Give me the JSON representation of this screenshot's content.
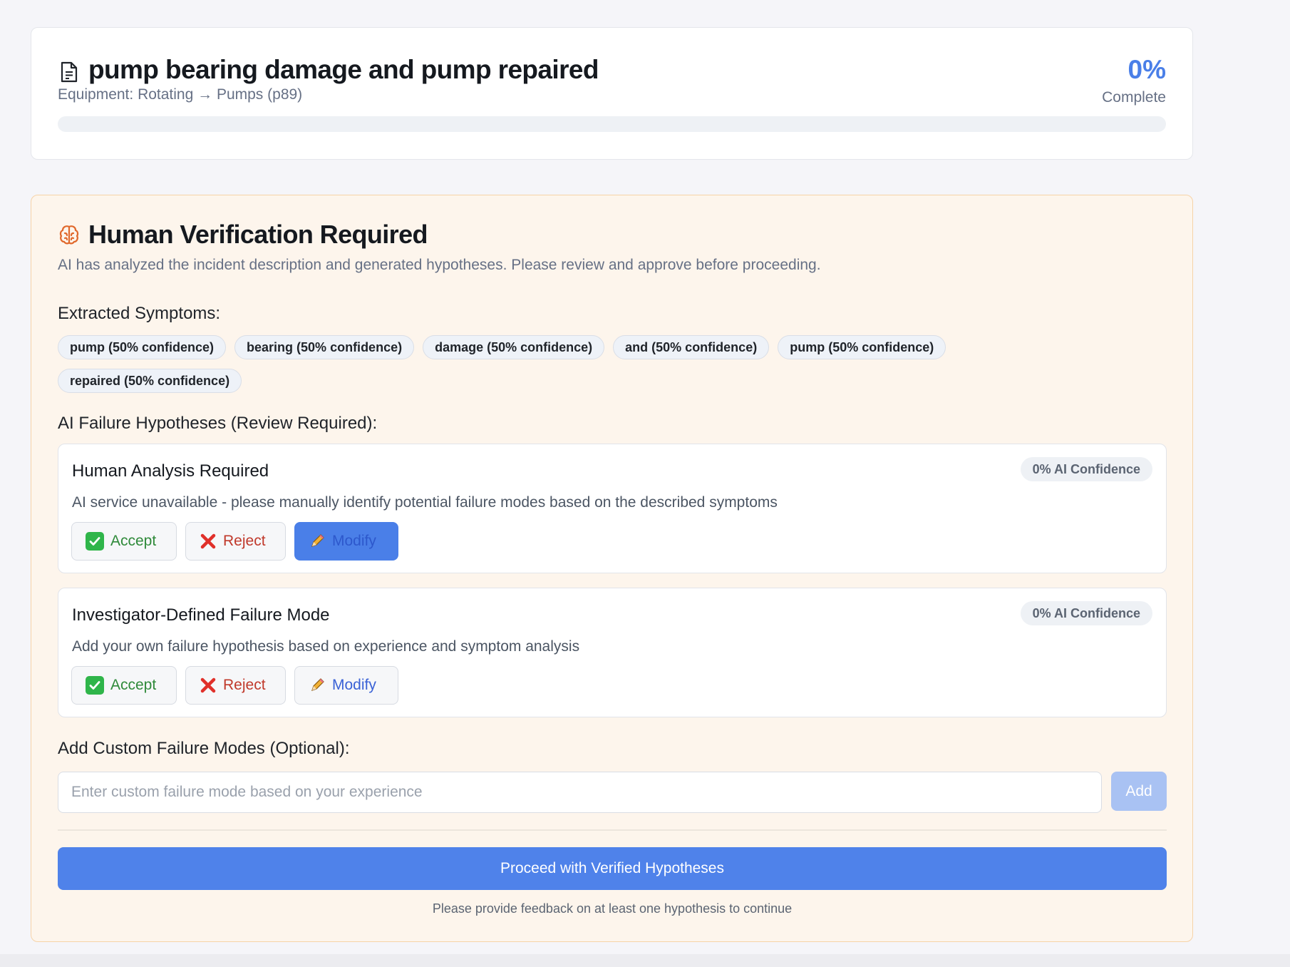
{
  "header": {
    "title": "pump bearing damage and pump repaired",
    "equipment": "Equipment: Rotating → Pumps (p89)",
    "progress_percent_text": "0%",
    "progress_label": "Complete",
    "progress_value": 0
  },
  "verification": {
    "title": "Human Verification Required",
    "subtitle": "AI has analyzed the incident description and generated hypotheses. Please review and approve before proceeding.",
    "symptoms_label": "Extracted Symptoms:",
    "symptoms": [
      "pump (50% confidence)",
      "bearing (50% confidence)",
      "damage (50% confidence)",
      "and (50% confidence)",
      "pump (50% confidence)",
      "repaired (50% confidence)"
    ],
    "hypotheses_label": "AI Failure Hypotheses (Review Required):",
    "hypotheses": [
      {
        "title": "Human Analysis Required",
        "confidence": "0% AI Confidence",
        "description": "AI service unavailable - please manually identify potential failure modes based on the described symptoms",
        "accept_label": "Accept",
        "reject_label": "Reject",
        "modify_label": "Modify"
      },
      {
        "title": "Investigator-Defined Failure Mode",
        "confidence": "0% AI Confidence",
        "description": "Add your own failure hypothesis based on experience and symptom analysis",
        "accept_label": "Accept",
        "reject_label": "Reject",
        "modify_label": "Modify"
      }
    ],
    "custom_label": "Add Custom Failure Modes (Optional):",
    "custom_placeholder": "Enter custom failure mode based on your experience",
    "custom_value": "",
    "add_label": "Add",
    "proceed_label": "Proceed with Verified Hypotheses",
    "proceed_hint": "Please provide feedback on at least one hypothesis to continue"
  },
  "icons": {
    "document": "document-icon",
    "brain": "brain-icon",
    "accept": "check-mark-icon",
    "reject": "cross-mark-icon",
    "modify": "pencil-icon"
  },
  "colors": {
    "accent": "#4a7fe8",
    "verify_bg": "#fdf5ec",
    "verify_border": "#f6d3a8",
    "accept": "#2f8a3a",
    "reject": "#c0392b",
    "modify": "#3a62d6",
    "brain_icon": "#e0682b"
  }
}
